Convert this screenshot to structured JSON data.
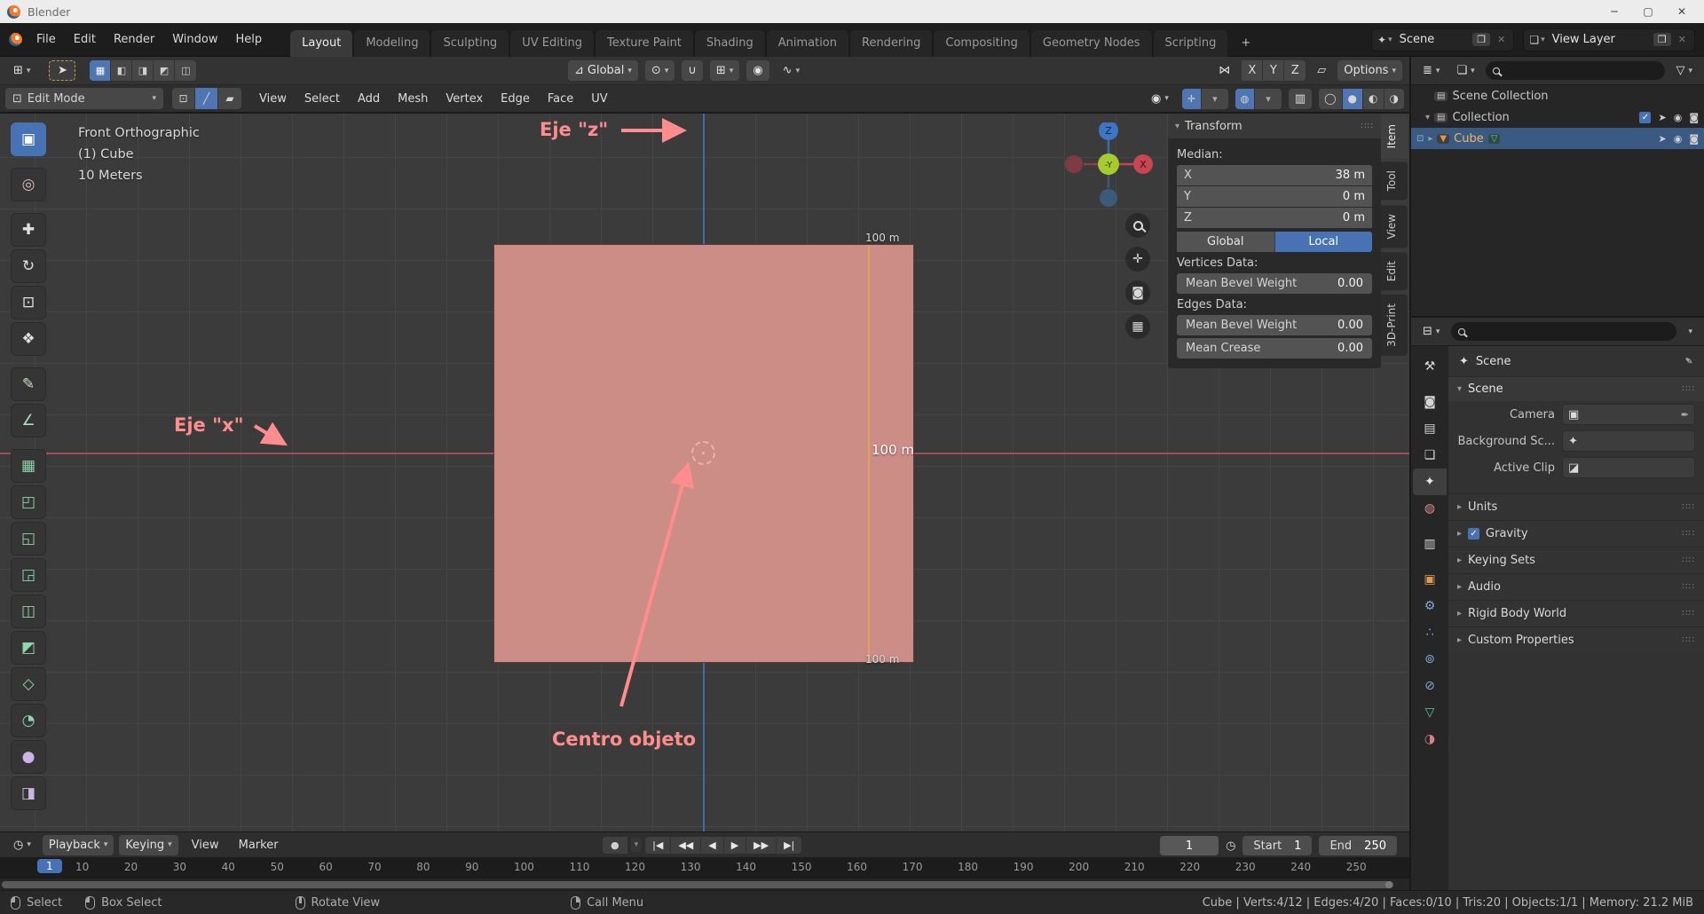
{
  "window": {
    "title": "Blender",
    "minimize": "─",
    "maximize": "▢",
    "close": "✕"
  },
  "topbar": {
    "menus": [
      "File",
      "Edit",
      "Render",
      "Window",
      "Help"
    ],
    "tabs": [
      {
        "label": "Layout",
        "cls": "active"
      },
      {
        "label": "Modeling"
      },
      {
        "label": "Sculpting"
      },
      {
        "label": "UV Editing"
      },
      {
        "label": "Texture Paint"
      },
      {
        "label": "Shading"
      },
      {
        "label": "Animation"
      },
      {
        "label": "Rendering"
      },
      {
        "label": "Compositing"
      },
      {
        "label": "Geometry Nodes"
      },
      {
        "label": "Scripting"
      },
      {
        "label": "+",
        "cls": "plus"
      }
    ],
    "scene": "Scene",
    "view_layer": "View Layer"
  },
  "tool_settings": {
    "orientation": "Global",
    "axis": [
      "X",
      "Y",
      "Z"
    ],
    "options": "Options"
  },
  "viewport_header": {
    "mode": "Edit Mode",
    "menus": [
      "View",
      "Select",
      "Add",
      "Mesh",
      "Vertex",
      "Edge",
      "Face",
      "UV"
    ]
  },
  "toolbar": {
    "tools": [
      {
        "glyph": "▣",
        "style": "color:#ffffff",
        "cls": "active",
        "name": "select-box"
      },
      {
        "glyph": "◎",
        "style": "color:#e0b7b7",
        "cls": "gap",
        "name": "cursor"
      },
      {
        "glyph": "✚",
        "style": "color:#e0e0e0",
        "cls": "gap",
        "name": "move"
      },
      {
        "glyph": "↻",
        "style": "color:#e0e0e0",
        "name": "rotate"
      },
      {
        "glyph": "⊡",
        "style": "color:#e0e0e0",
        "name": "scale"
      },
      {
        "glyph": "❖",
        "style": "color:#e0e0e0",
        "name": "transform"
      },
      {
        "glyph": "✎",
        "style": "color:#bfe3c6",
        "cls": "gap",
        "name": "annotate"
      },
      {
        "glyph": "∠",
        "style": "color:#a9dfc0",
        "name": "measure"
      },
      {
        "glyph": "▦",
        "style": "color:#8fd6a9",
        "cls": "gap",
        "name": "add-cube"
      },
      {
        "glyph": "◰",
        "style": "color:#8fd6a9",
        "name": "extrude-region"
      },
      {
        "glyph": "◱",
        "style": "color:#8fd6a9",
        "name": "inset-faces"
      },
      {
        "glyph": "◲",
        "style": "color:#8fd6a9",
        "name": "bevel"
      },
      {
        "glyph": "◫",
        "style": "color:#8fd6a9",
        "name": "loop-cut"
      },
      {
        "glyph": "◩",
        "style": "color:#8fd6a9",
        "name": "knife"
      },
      {
        "glyph": "◇",
        "style": "color:#8fd6a9",
        "name": "poly-build"
      },
      {
        "glyph": "◔",
        "style": "color:#8fd6a9",
        "name": "spin"
      },
      {
        "glyph": "●",
        "style": "color:#cbb3e3",
        "name": "smooth"
      },
      {
        "glyph": "◨",
        "style": "color:#cbb3e3",
        "name": "edge-slide"
      }
    ]
  },
  "viewport": {
    "info": [
      "Front Orthographic",
      "(1) Cube",
      "10 Meters"
    ],
    "edge_lengths": [
      "100 m",
      "100 m",
      "100 m"
    ],
    "annotations": {
      "z": "Eje \"z\"",
      "x": "Eje \"x\"",
      "center": "Centro objeto"
    },
    "gizmo": {
      "z": "Z",
      "x": "X",
      "y": "-Y"
    }
  },
  "npanel": {
    "title": "Transform",
    "grip": "∷∷",
    "median_label": "Median:",
    "median": [
      {
        "axis": "X",
        "value": "38 m"
      },
      {
        "axis": "Y",
        "value": "0 m"
      },
      {
        "axis": "Z",
        "value": "0 m"
      }
    ],
    "space_buttons": [
      {
        "label": "Global"
      },
      {
        "label": "Local",
        "cls": "on"
      }
    ],
    "vertices_label": "Vertices Data:",
    "vertex_rows": [
      {
        "label": "Mean Bevel Weight",
        "value": "0.00"
      }
    ],
    "edges_label": "Edges Data:",
    "edge_rows": [
      {
        "label": "Mean Bevel Weight",
        "value": "0.00"
      },
      {
        "label": "Mean Crease",
        "value": "0.00"
      }
    ],
    "tabs": [
      {
        "label": "Item",
        "cls": "active"
      },
      {
        "label": "Tool"
      },
      {
        "label": "View"
      },
      {
        "label": "Edit"
      },
      {
        "label": "3D-Print"
      }
    ]
  },
  "outliner": {
    "scene_collection": "Scene Collection",
    "collection": "Collection",
    "cube": "Cube"
  },
  "properties": {
    "breadcrumb": "Scene",
    "panel_title": "Scene",
    "fields": [
      {
        "label": "Camera",
        "icon": "▣",
        "tail": "✒"
      },
      {
        "label": "Background Sc...",
        "icon": "✦",
        "tail": ""
      },
      {
        "label": "Active Clip",
        "icon": "◪",
        "tail": ""
      }
    ],
    "sections": [
      {
        "label": "Units"
      },
      {
        "label": "Gravity",
        "cb": true
      },
      {
        "label": "Keying Sets"
      },
      {
        "label": "Audio"
      },
      {
        "label": "Rigid Body World"
      },
      {
        "label": "Custom Properties"
      }
    ],
    "tabs": [
      {
        "glyph": "⚒",
        "style": "color:#d5d5d5",
        "name": "tool"
      },
      {
        "glyph": "◙",
        "style": "color:#d5d5d5",
        "cls": "gap",
        "name": "render"
      },
      {
        "glyph": "▤",
        "style": "color:#d5d5d5",
        "name": "output"
      },
      {
        "glyph": "❏",
        "style": "color:#d5d5d5",
        "name": "view-layer"
      },
      {
        "glyph": "✦",
        "style": "color:#e8e8e8",
        "cls": "active",
        "name": "scene"
      },
      {
        "glyph": "◍",
        "style": "color:#d98b8b",
        "name": "world"
      },
      {
        "glyph": "▥",
        "style": "color:#d5d5d5",
        "cls": "gap",
        "name": "collection"
      },
      {
        "glyph": "▣",
        "style": "color:#dd9b50",
        "cls": "gap",
        "name": "object"
      },
      {
        "glyph": "⚙",
        "style": "color:#7fa8dc",
        "name": "modifiers"
      },
      {
        "glyph": "∴",
        "style": "color:#7fa8dc",
        "name": "particles"
      },
      {
        "glyph": "⊚",
        "style": "color:#7fa8dc",
        "name": "physics"
      },
      {
        "glyph": "⊘",
        "style": "color:#7fa8dc",
        "name": "constraints"
      },
      {
        "glyph": "▽",
        "style": "color:#55c894",
        "name": "object-data"
      },
      {
        "glyph": "◑",
        "style": "color:#d97f88",
        "name": "material"
      }
    ]
  },
  "timeline": {
    "playback": "Playback",
    "keying": "Keying",
    "view": "View",
    "marker": "Marker",
    "transport": [
      {
        "glyph": "|◀",
        "name": "jump-to-start"
      },
      {
        "glyph": "◀◀",
        "name": "previous-keyframe"
      },
      {
        "glyph": "◀",
        "name": "play-reverse"
      },
      {
        "glyph": "▶",
        "name": "play"
      },
      {
        "glyph": "▶▶",
        "name": "next-keyframe"
      },
      {
        "glyph": "▶|",
        "name": "jump-to-end"
      }
    ],
    "frame": "1",
    "current_frame": "1",
    "start_label": "Start",
    "start": "1",
    "end_label": "End",
    "end": "250",
    "ruler": [
      "10",
      "20",
      "30",
      "40",
      "50",
      "60",
      "70",
      "80",
      "90",
      "100",
      "110",
      "120",
      "130",
      "140",
      "150",
      "160",
      "170",
      "180",
      "190",
      "200",
      "210",
      "220",
      "230",
      "240",
      "250"
    ]
  },
  "statusbar": {
    "hints": [
      {
        "label": "Select",
        "m": "m-left"
      },
      {
        "label": "Box Select",
        "m": "m-left",
        "cls": "g1"
      },
      {
        "label": "Rotate View",
        "m": "m-mid",
        "cls": "g2"
      },
      {
        "label": "Call Menu",
        "m": "m-right",
        "cls": "g3"
      }
    ],
    "stats": "Cube | Verts:4/12 | Edges:4/20 | Faces:0/10 | Tris:20 | Objects:1/1 | Memory: 21.2 MiB"
  },
  "colors": {
    "accent": "#4772b3",
    "annotation": "#ff8d8d",
    "selected_edge": "#e2a25e",
    "axis_x": "#a04e58",
    "axis_z": "#3d6ea3",
    "face": "#cb8d85"
  }
}
